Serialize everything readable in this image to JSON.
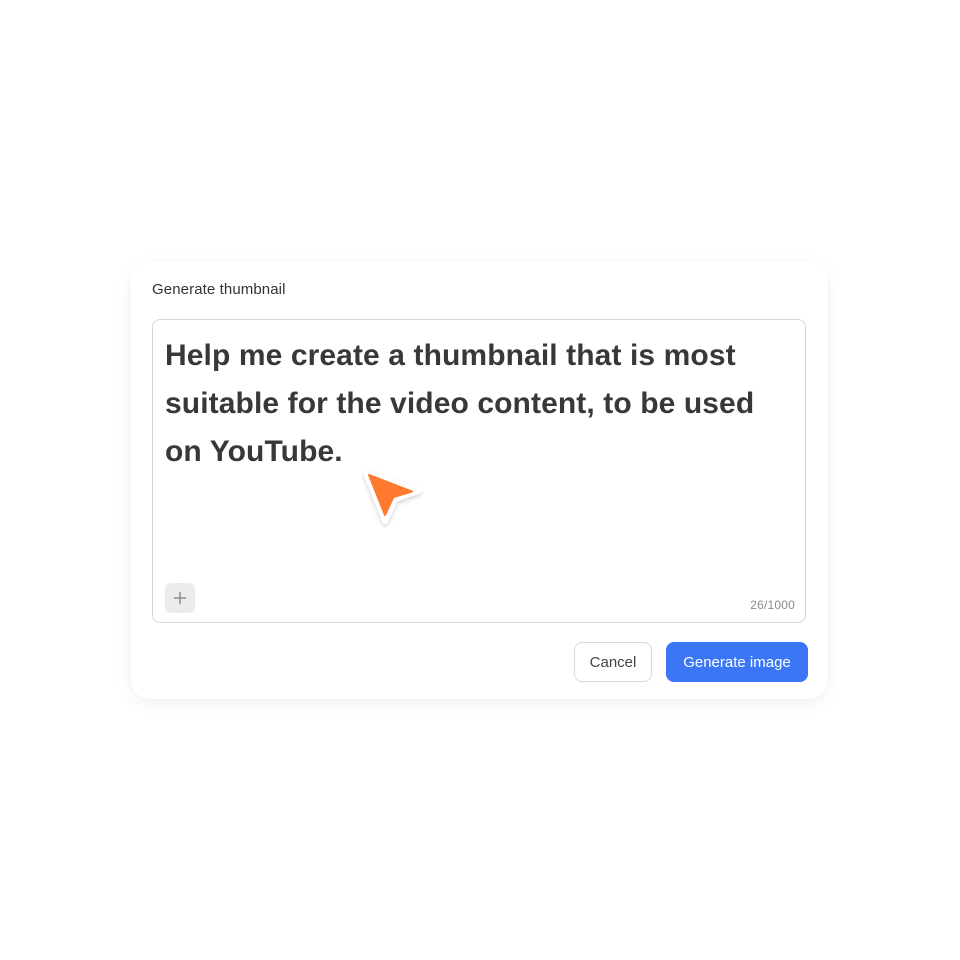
{
  "dialog": {
    "title": "Generate thumbnail",
    "prompt": {
      "value": "Help me create a thumbnail that is most suitable for the video content, to be used on YouTube.",
      "counter": "26/1000",
      "add_icon": "plus-icon"
    },
    "actions": {
      "cancel_label": "Cancel",
      "generate_label": "Generate image"
    }
  },
  "cursor": {
    "icon": "pointer-arrow-icon",
    "color": "#ff7a2f"
  },
  "colors": {
    "accent": "#3b76f6",
    "text": "#383838",
    "border": "#d6d6d6"
  }
}
